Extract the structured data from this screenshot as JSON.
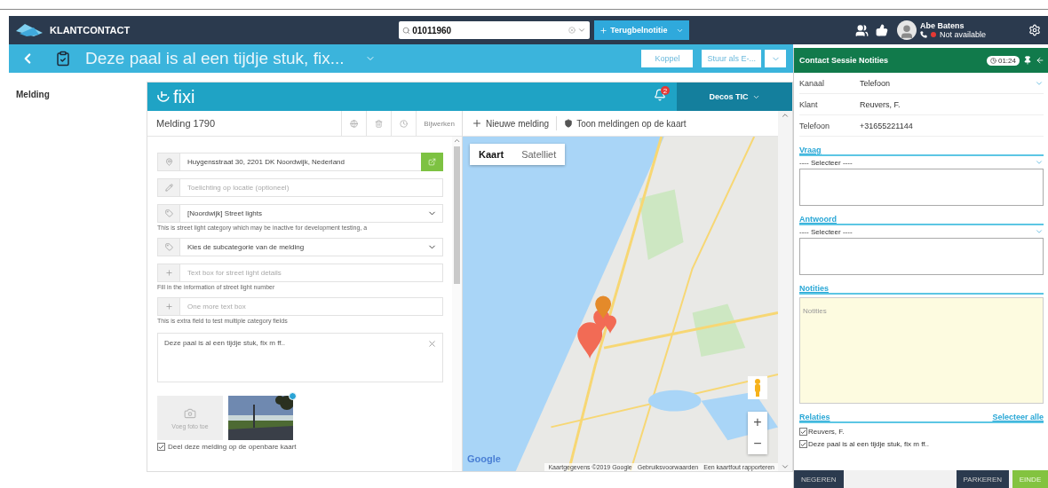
{
  "topbar": {
    "app_title": "KLANTCONTACT",
    "search": {
      "value": "01011960"
    },
    "callback_button": "Terugbelnotitie",
    "user": {
      "name": "Abe Batens",
      "status": "Not available",
      "available": false
    }
  },
  "subbar": {
    "title": "Deze paal is al een tijdje stuk, fix...",
    "buttons": [
      "Koppel",
      "Stuur als E-..."
    ]
  },
  "sidebar": {
    "label": "Melding"
  },
  "fixi": {
    "logo": "fixi",
    "notification_count": "2",
    "org_menu": "Decos TIC",
    "report": {
      "title": "Melding 1790",
      "update_button": "Bijwerken"
    },
    "fields": [
      {
        "kind": "address",
        "value": "Huygensstraat 30, 2201 DK Noordwijk, Nederland"
      },
      {
        "kind": "remark",
        "placeholder": "Toelichting op locatie (optioneel)"
      },
      {
        "kind": "select",
        "value": "[Noordwijk] Street lights",
        "hint": "This is street light category which may be inactive for development testing, a"
      },
      {
        "kind": "select",
        "value": "Kies de subcategorie van de melding"
      },
      {
        "kind": "extra",
        "placeholder": "Text box for street light details",
        "hint": "Fill in the information of street light number"
      },
      {
        "kind": "extra",
        "placeholder": "One more text box",
        "hint": "This is extra field to test multiple category fields"
      }
    ],
    "description": "Deze paal is al een tijdje stuk, fix m ff..",
    "add_photo": "Voeg foto toe",
    "share": {
      "label": "Deel deze melding op de openbare kaart",
      "checked": true
    },
    "map_toolbar": [
      "Nieuwe melding",
      "Toon meldingen op de kaart"
    ],
    "map": {
      "types": [
        {
          "label": "Kaart",
          "selected": true
        },
        {
          "label": "Satelliet",
          "selected": false
        }
      ],
      "zoom_in": "+",
      "zoom_out": "−",
      "logo": "Google",
      "attribution": [
        "Kaartgegevens ©2019 Google",
        "Gebruiksvoorwaarden",
        "Een kaartfout rapporteren"
      ]
    }
  },
  "session": {
    "title": "Contact Sessie Notities",
    "timer": "01:24",
    "details": [
      {
        "kind": "select",
        "label": "Kanaal",
        "value": "Telefoon"
      },
      {
        "kind": "text",
        "label": "Klant",
        "value": "Reuvers, F."
      },
      {
        "kind": "text",
        "label": "Telefoon",
        "value": "+31655221144"
      }
    ],
    "questions": [
      {
        "heading": "Vraag",
        "select": "---- Selecteer ----"
      },
      {
        "heading": "Antwoord",
        "select": "---- Selecteer ----"
      }
    ],
    "notes": {
      "heading": "Notities",
      "placeholder": "Notities"
    },
    "relations": {
      "heading": "Relaties",
      "select_all": "Selecteer alle",
      "items": [
        {
          "label": "Reuvers, F.",
          "checked": true
        },
        {
          "label": "Deze paal is al een tijdje stuk, fix m ff..",
          "checked": true
        }
      ]
    },
    "footer": {
      "ignore": "NEGEREN",
      "park": "PARKEREN",
      "end": "EINDE"
    }
  }
}
